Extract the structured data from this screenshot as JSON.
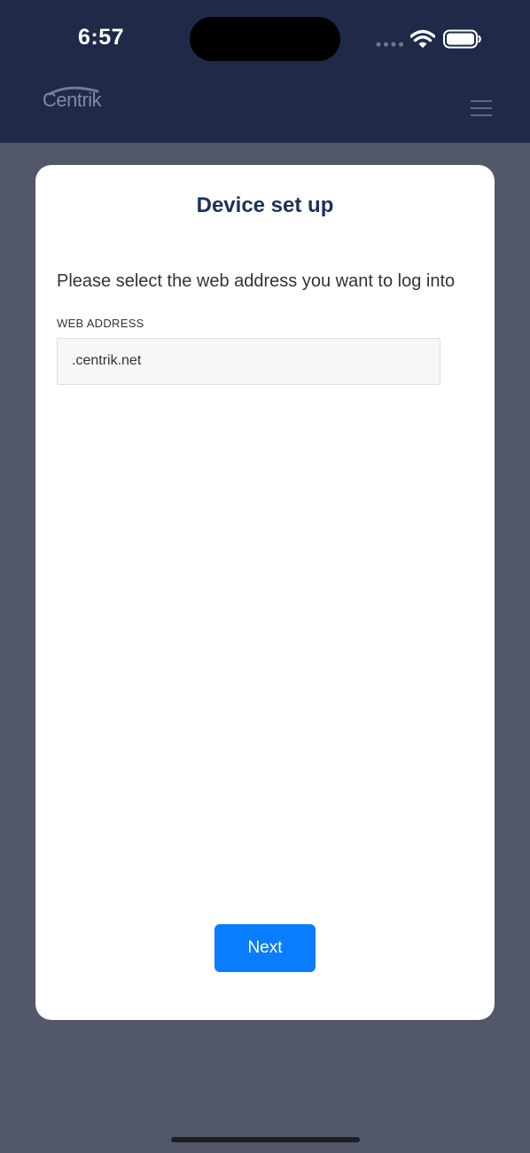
{
  "status_bar": {
    "time": "6:57"
  },
  "header": {
    "logo_text": "Centrik",
    "menu_icon": "hamburger-menu-icon"
  },
  "card": {
    "title": "Device set up",
    "instruction": "Please select the web address you want to log into",
    "field_label": "WEB ADDRESS",
    "web_address_value": ".centrik.net",
    "next_label": "Next"
  },
  "colors": {
    "header_bg": "#1e2a47",
    "page_bg": "#525868",
    "title": "#1c3158",
    "accent": "#0a7cff"
  }
}
